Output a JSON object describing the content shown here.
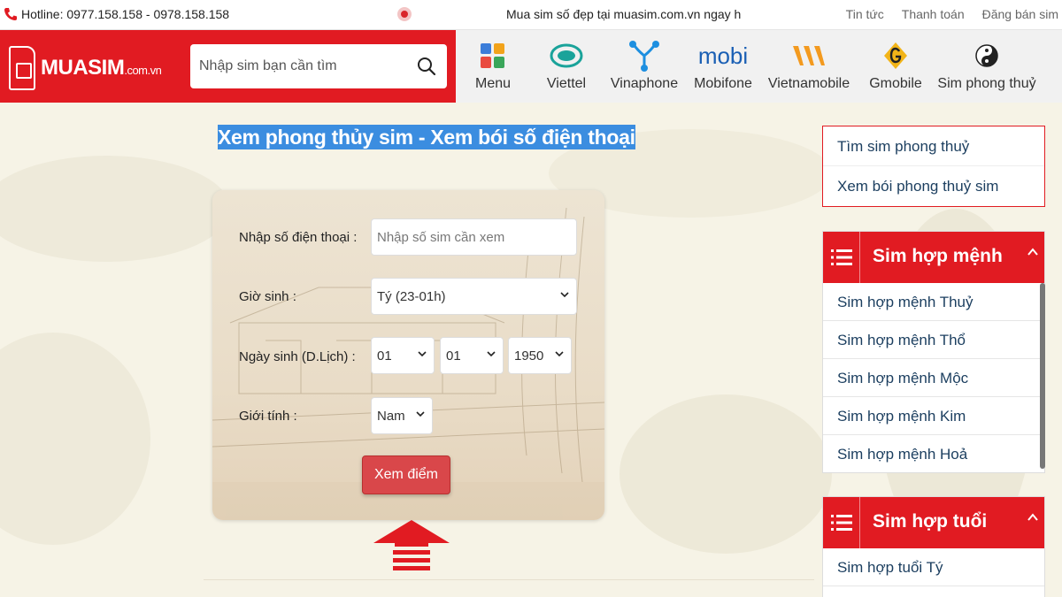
{
  "topbar": {
    "hotline_label": "Hotline: 0977.158.158 - 0978.158.158",
    "marquee": "Mua sim số đẹp tại muasim.com.vn ngay h",
    "links": [
      "Tin tức",
      "Thanh toán",
      "Đăng bán sim"
    ]
  },
  "header": {
    "logo_main": "MUASIM",
    "logo_sub": ".com.vn",
    "search_placeholder": "Nhập sim bạn cần tìm",
    "nav": [
      {
        "label": "Menu",
        "icon": "menu-grid-icon"
      },
      {
        "label": "Viettel",
        "icon": "viettel-logo-icon"
      },
      {
        "label": "Vinaphone",
        "icon": "vinaphone-logo-icon"
      },
      {
        "label": "Mobifone",
        "icon": "mobifone-logo-icon",
        "logo_text": "mobi"
      },
      {
        "label": "Vietnamobile",
        "icon": "vietnamobile-logo-icon"
      },
      {
        "label": "Gmobile",
        "icon": "gmobile-logo-icon"
      },
      {
        "label": "Sim phong thuỷ",
        "icon": "yin-yang-icon"
      }
    ]
  },
  "main": {
    "title": "Xem phong thủy sim - Xem bói số điện thoại",
    "form": {
      "phone_label": "Nhập số điện thoại :",
      "phone_placeholder": "Nhập số sim cần xem",
      "hour_label": "Giờ sinh :",
      "hour_value": "Tý (23-01h)",
      "dob_label": "Ngày sinh (D.Lịch) :",
      "day_value": "01",
      "month_value": "01",
      "year_value": "1950",
      "gender_label": "Giới tính :",
      "gender_value": "Nam",
      "submit_label": "Xem điểm"
    }
  },
  "sidebar": {
    "quick_links": [
      "Tìm sim phong thuỷ",
      "Xem bói phong thuỷ sim"
    ],
    "panel_menh": {
      "title": "Sim hợp mệnh",
      "items": [
        "Sim hợp mệnh Thuỷ",
        "Sim hợp mệnh Thổ",
        "Sim hợp mệnh Mộc",
        "Sim hợp mệnh Kim",
        "Sim hợp mệnh Hoả"
      ]
    },
    "panel_tuoi": {
      "title": "Sim hợp tuổi",
      "items": [
        "Sim hợp tuổi Tý"
      ]
    }
  },
  "colors": {
    "brand_red": "#e11b22",
    "highlight_blue": "#3b8de0",
    "button_red": "#d9474a"
  }
}
